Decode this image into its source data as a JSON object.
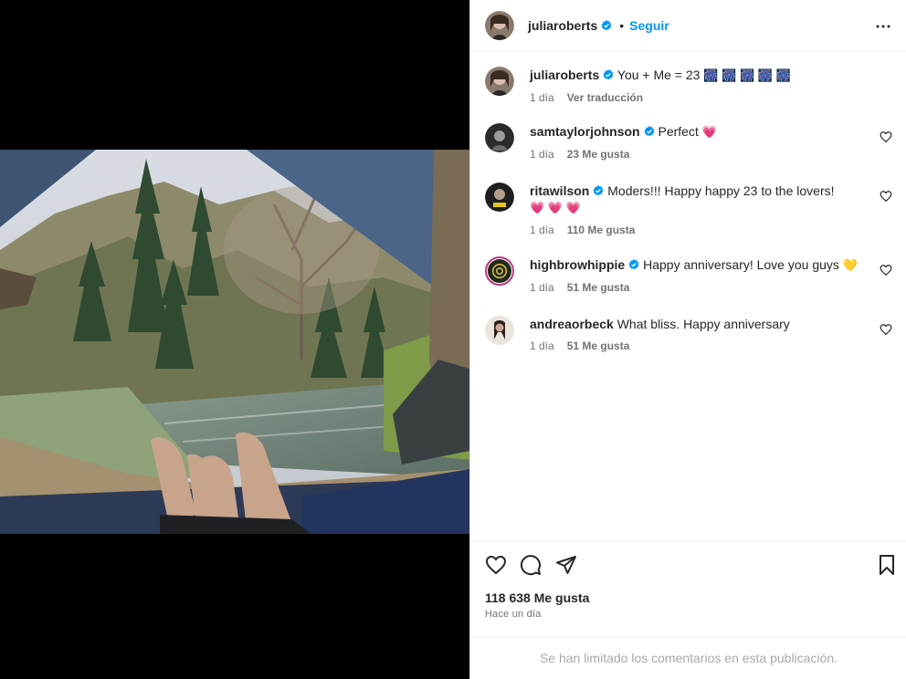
{
  "post": {
    "author": "juliaroberts",
    "follow_label": "Seguir",
    "separator": "•",
    "caption": "You + Me = 23",
    "caption_emojis": "🎆 🎆 🎆 🎆 🎆",
    "caption_time": "1 día",
    "translate_label": "Ver traducción"
  },
  "comments": [
    {
      "user": "samtaylorjohnson",
      "verified": true,
      "text": "Perfect",
      "emoji": "💗",
      "time": "1 día",
      "likes": "23 Me gusta"
    },
    {
      "user": "ritawilson",
      "verified": true,
      "text": "Moders!!! Happy happy 23 to the lovers!",
      "emoji": "💗 💗 💗",
      "time": "1 día",
      "likes": "110 Me gusta"
    },
    {
      "user": "highbrowhippie",
      "verified": true,
      "text": "Happy anniversary! Love you guys",
      "emoji": "💛",
      "time": "1 día",
      "likes": "51 Me gusta"
    },
    {
      "user": "andreaorbeck",
      "verified": false,
      "text": "What bliss. Happy anniversary",
      "emoji": "",
      "time": "1 día",
      "likes": "51 Me gusta"
    }
  ],
  "footer": {
    "likes_count": "118 638 Me gusta",
    "time_ago": "Hace un día",
    "comments_limited": "Se han limitado los comentarios en esta publicación."
  },
  "icons": {
    "verified": "verified-badge-icon",
    "more": "more-options-icon",
    "like": "heart-icon",
    "comment": "comment-icon",
    "share": "share-icon",
    "save": "bookmark-icon"
  },
  "colors": {
    "accent": "#0095f6",
    "verified": "#0095f6",
    "muted": "#737373",
    "limited_text": "#a8a8a8"
  }
}
